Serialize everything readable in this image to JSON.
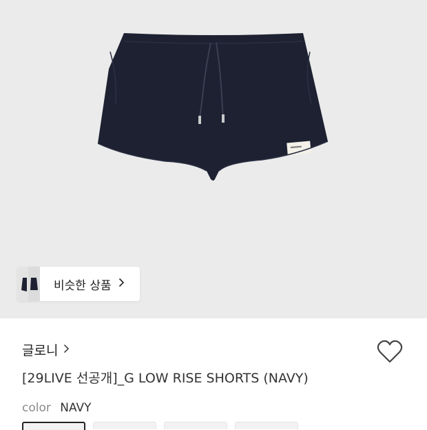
{
  "product": {
    "brand": "글로니",
    "title": "[29LIVE 선공개]_G LOW RISE SHORTS (NAVY)",
    "color_label": "color",
    "color_value": "NAVY"
  },
  "similar": {
    "label": "비슷한 상품"
  },
  "icons": {
    "brand_chevron": "chevron-right-icon",
    "similar_chevron": "chevron-right-icon",
    "wishlist": "heart-icon"
  },
  "colors": {
    "hero_bg": "#ebebeb",
    "product_navy": "#1d2131",
    "text": "#222222"
  },
  "swatches": [
    {
      "selected": true
    },
    {
      "selected": false
    },
    {
      "selected": false
    },
    {
      "selected": false
    }
  ]
}
